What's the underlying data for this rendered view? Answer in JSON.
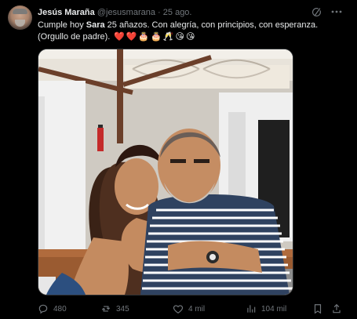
{
  "author": {
    "display_name": "Jesús Maraña",
    "handle": "@jesusmarana",
    "separator": "·",
    "date": "25 ago."
  },
  "post": {
    "line1_prefix": "Cumple hoy ",
    "line1_name": "Sara",
    "line1_suffix": " 25 añazos. Con alegría, con principios, con esperanza.",
    "line2_text": "(Orgullo de padre).",
    "emojis": [
      "❤️",
      "❤️",
      "🎂",
      "🎂",
      "🥂",
      "😘",
      "😘"
    ]
  },
  "header_icons": [
    "grok-icon",
    "more-icon"
  ],
  "actions": {
    "replies": "480",
    "reposts": "345",
    "likes": "4 mil",
    "views": "104 mil"
  },
  "colors": {
    "background": "#000000",
    "text": "#e7e9ea",
    "muted": "#71767b"
  }
}
